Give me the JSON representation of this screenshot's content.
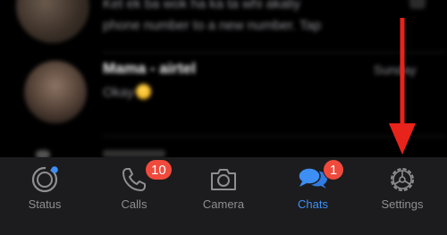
{
  "chats": [
    {
      "name": "",
      "preview_line1": "Ket ek ba wok ha ka ta whi akaliy",
      "preview_line2": "phone number to a new number. Tap",
      "time": ""
    },
    {
      "name": "Mama - airtel",
      "preview": "Okay",
      "time": "Sunday"
    }
  ],
  "tabs": [
    {
      "label": "Status",
      "icon": "status-icon",
      "badge": ""
    },
    {
      "label": "Calls",
      "icon": "phone-icon",
      "badge": "10"
    },
    {
      "label": "Camera",
      "icon": "camera-icon",
      "badge": ""
    },
    {
      "label": "Chats",
      "icon": "chats-icon",
      "badge": "1"
    },
    {
      "label": "Settings",
      "icon": "gear-icon",
      "badge": ""
    }
  ],
  "colors": {
    "active_tab": "#3d8ff5",
    "badge": "#f04a3c",
    "arrow": "#e8231c",
    "tabbar_bg": "#1c1c1e"
  }
}
